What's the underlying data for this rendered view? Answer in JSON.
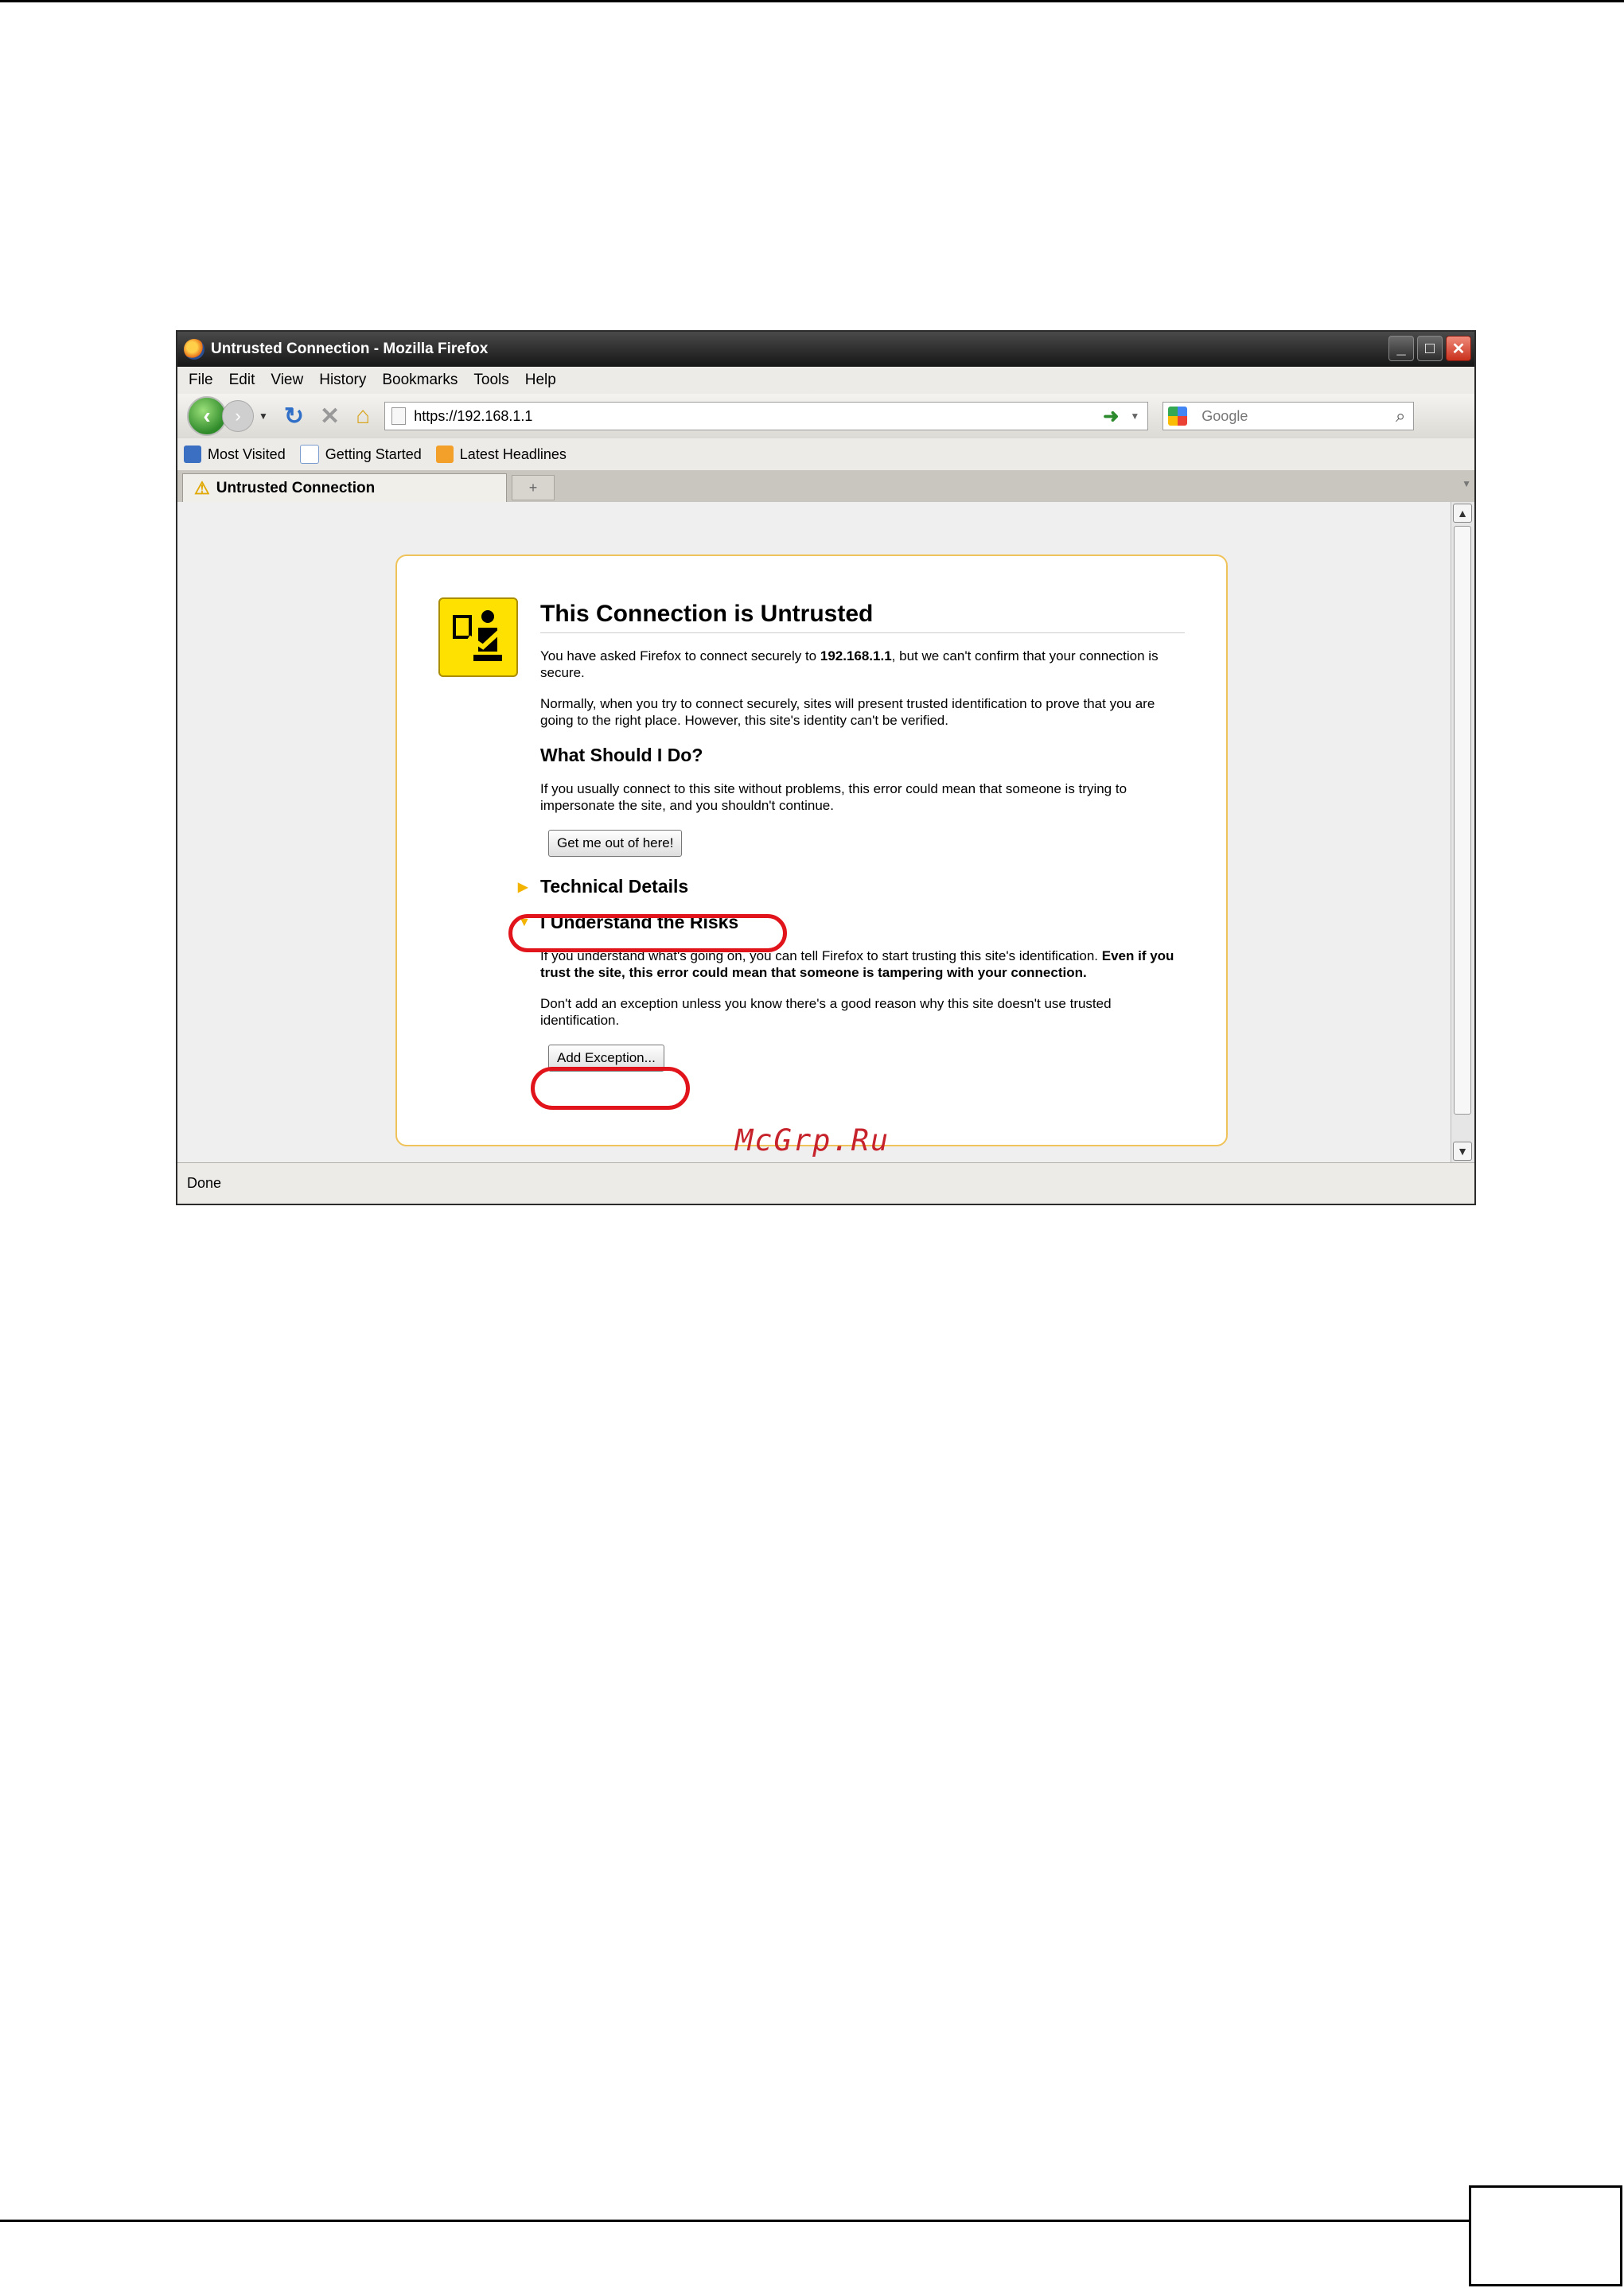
{
  "window": {
    "title": "Untrusted Connection - Mozilla Firefox",
    "controls": {
      "minimize": "_",
      "maximize": "□",
      "close": "✕"
    }
  },
  "menubar": {
    "items": [
      "File",
      "Edit",
      "View",
      "History",
      "Bookmarks",
      "Tools",
      "Help"
    ]
  },
  "navbar": {
    "back_glyph": "‹",
    "forward_glyph": "›",
    "reload_glyph": "↻",
    "stop_glyph": "✕",
    "home_glyph": "⌂",
    "url": "https://192.168.1.1",
    "go_glyph": "➜",
    "search_placeholder": "Google",
    "search_glyph": "⌕"
  },
  "bookmarks": {
    "items": [
      "Most Visited",
      "Getting Started",
      "Latest Headlines"
    ]
  },
  "tabs": {
    "active_label": "Untrusted Connection",
    "warn_glyph": "⚠",
    "new_tab_glyph": "+"
  },
  "error_page": {
    "title": "This Connection is Untrusted",
    "intro_pre": "You have asked Firefox to connect securely to ",
    "intro_host": "192.168.1.1",
    "intro_post": ", but we can't confirm that your connection is secure.",
    "normally": "Normally, when you try to connect securely, sites will present trusted identification to prove that you are going to the right place. However, this site's identity can't be verified.",
    "what_heading": "What Should I Do?",
    "what_text": "If you usually connect to this site without problems, this error could mean that someone is trying to impersonate the site, and you shouldn't continue.",
    "get_out_button": "Get me out of here!",
    "technical_details": "Technical Details",
    "understand_risks": "I Understand the Risks",
    "risks_text_pre": "If you understand what's going on, you can tell Firefox to start trusting this site's identification. ",
    "risks_text_bold": "Even if you trust the site, this error could mean that someone is tampering with your connection.",
    "exception_text": "Don't add an exception unless you know there's a good reason why this site doesn't use trusted identification.",
    "add_exception_button": "Add Exception..."
  },
  "status": {
    "text": "Done"
  },
  "watermark": "McGrp.Ru",
  "colors": {
    "highlight_ring": "#e2141b",
    "panel_border": "#f0c35a",
    "cert_icon": "#ffe100"
  }
}
